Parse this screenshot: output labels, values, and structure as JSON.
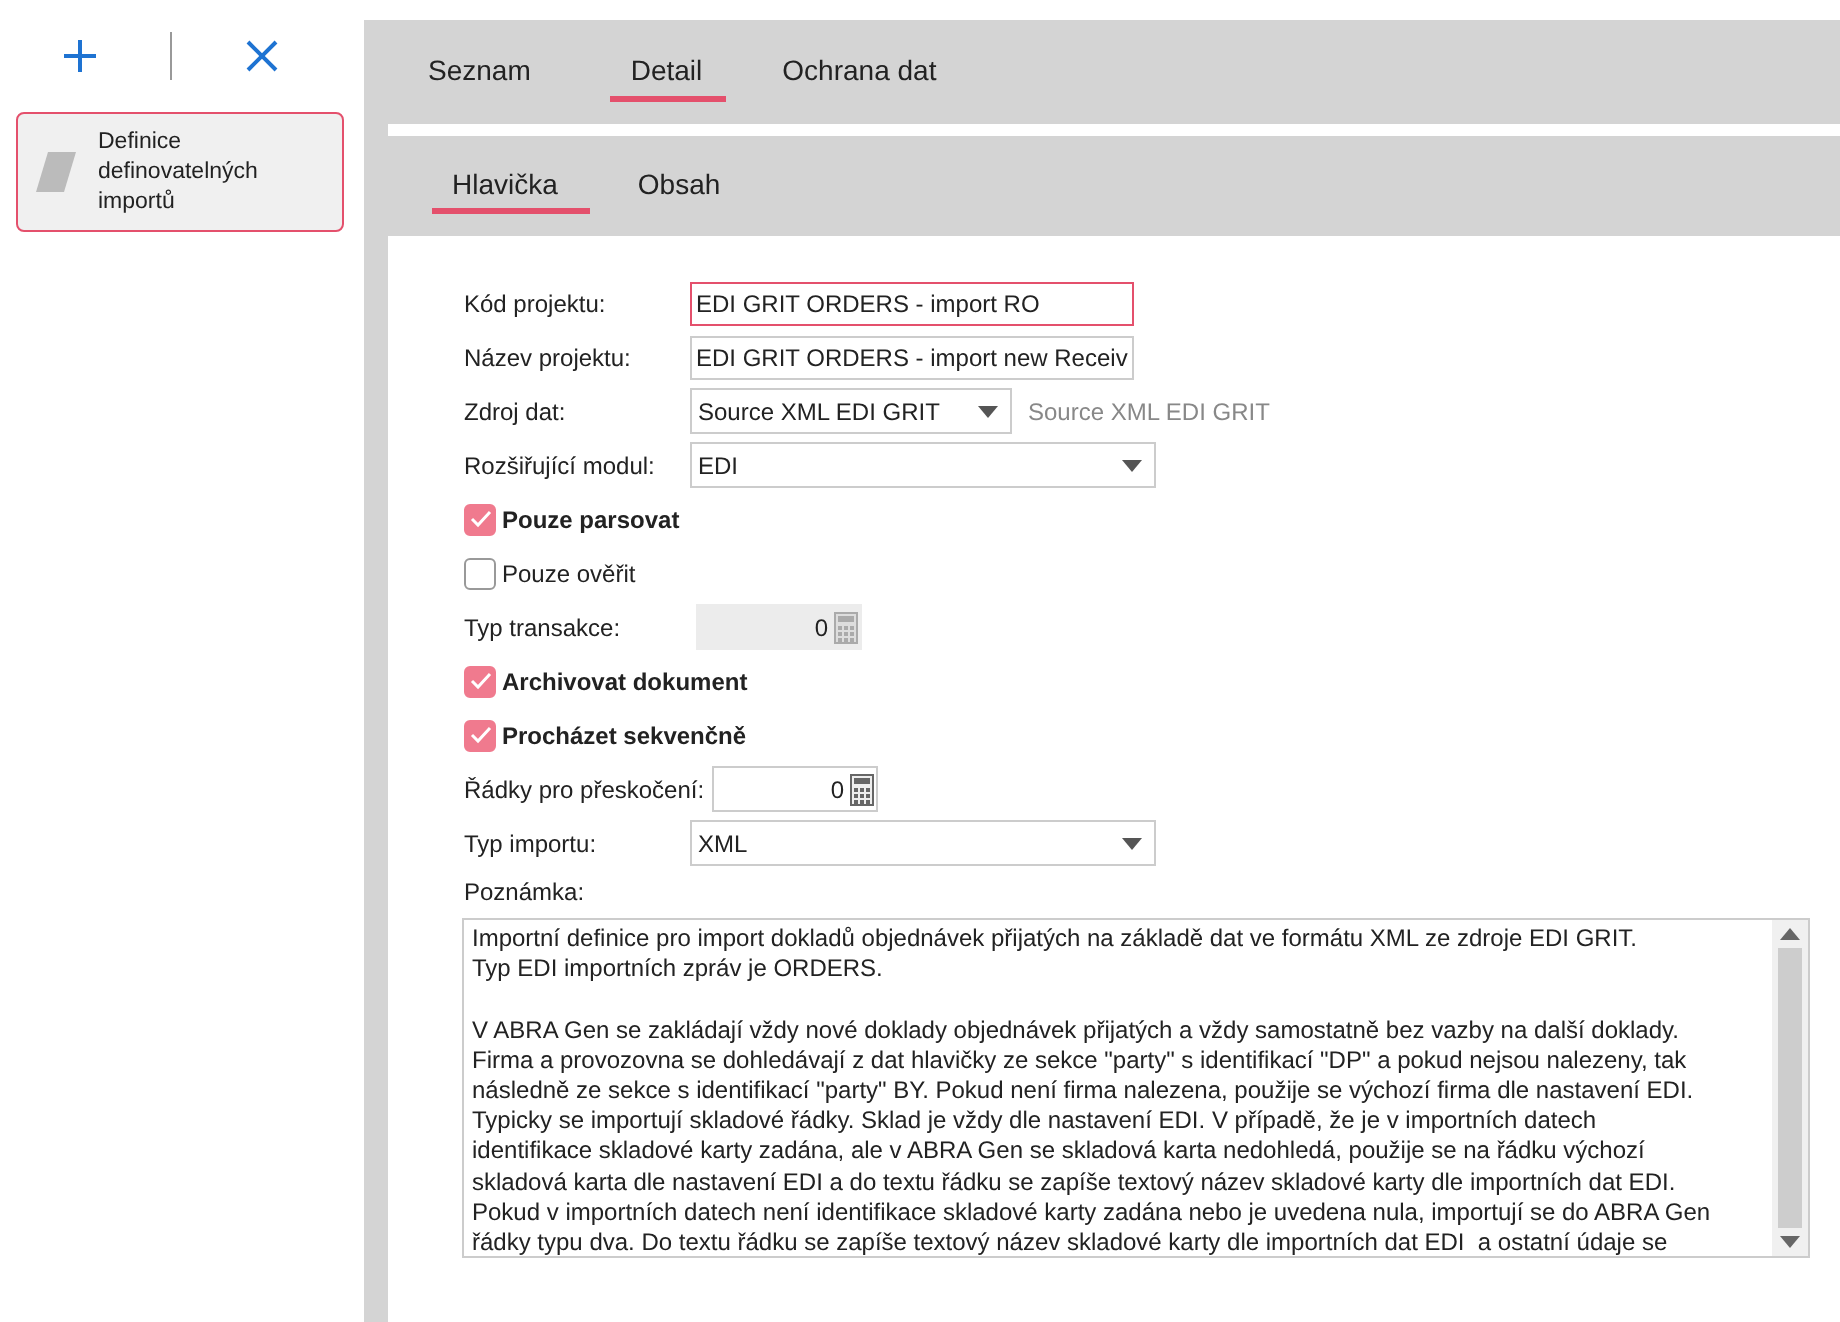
{
  "toolbar": {
    "buttons": [
      {
        "kind": "add"
      },
      {
        "kind": "delete"
      }
    ]
  },
  "sidebar": {
    "items": [
      {
        "label": "Definice definovatelných importů",
        "selected": true
      }
    ]
  },
  "tabs": [
    {
      "label": "Seznam",
      "selected": false
    },
    {
      "label": "Detail",
      "selected": true
    },
    {
      "label": "Ochrana dat",
      "selected": false
    }
  ],
  "subtabs": [
    {
      "label": "Hlavička",
      "selected": true
    },
    {
      "label": "Obsah",
      "selected": false
    }
  ],
  "fields": [
    {
      "kind": "text",
      "label": "Kód projektu:",
      "value": "EDI GRIT ORDERS - import RO",
      "focused": true
    },
    {
      "kind": "text",
      "label": "Název projektu:",
      "value": "EDI GRIT ORDERS - import new Receiv",
      "focused": false
    },
    {
      "kind": "select",
      "label": "Zdroj dat:",
      "value": "Source XML EDI GRIT",
      "hint": "Source XML EDI GRIT",
      "wide": false
    },
    {
      "kind": "select",
      "label": "Rozšiřující modul:",
      "value": "EDI",
      "wide": true
    },
    {
      "kind": "checkbox",
      "label": "Pouze parsovat",
      "checked": true
    },
    {
      "kind": "checkbox",
      "label": "Pouze ověřit",
      "checked": false
    },
    {
      "kind": "number",
      "label": "Typ transakce:",
      "value": "0",
      "disabled": true
    },
    {
      "kind": "checkbox",
      "label": "Archivovat dokument",
      "checked": true
    },
    {
      "kind": "checkbox",
      "label": "Procházet sekvenčně",
      "checked": true
    },
    {
      "kind": "number",
      "label": "Řádky pro přeskočení:",
      "value": "0",
      "disabled": false
    },
    {
      "kind": "select",
      "label": "Typ importu:",
      "value": "XML",
      "wide": true
    }
  ],
  "note": {
    "label": "Poznámka:",
    "text": "Importní definice pro import dokladů objednávek přijatých na základě dat ve formátu XML ze zdroje EDI GRIT.\nTyp EDI importních zpráv je ORDERS.\n\nV ABRA Gen se zakládají vždy nové doklady objednávek přijatých a vždy samostatně bez vazby na další doklady.\nFirma a provozovna se dohledávají z dat hlavičky ze sekce \"party\" s identifikací \"DP\" a pokud nejsou nalezeny, tak\nnásledně ze sekce s identifikací \"party\" BY. Pokud není firma nalezena, použije se výchozí firma dle nastavení EDI.\nTypicky se importují skladové řádky. Sklad je vždy dle nastavení EDI. V případě, že je v importních datech\nidentifikace skladové karty zadána, ale v ABRA Gen se skladová karta nedohledá, použije se na řádku výchozí\nskladová karta dle nastavení EDI a do textu řádku se zapíše textový název skladové karty dle importních dat EDI.\nPokud v importních datech není identifikace skladové karty zadána nebo je uvedena nula, importují se do ABRA Gen\nřádky typu dva. Do textu řádku se zapíše textový název skladové karty dle importních dat EDI  a ostatní údaje se"
  }
}
